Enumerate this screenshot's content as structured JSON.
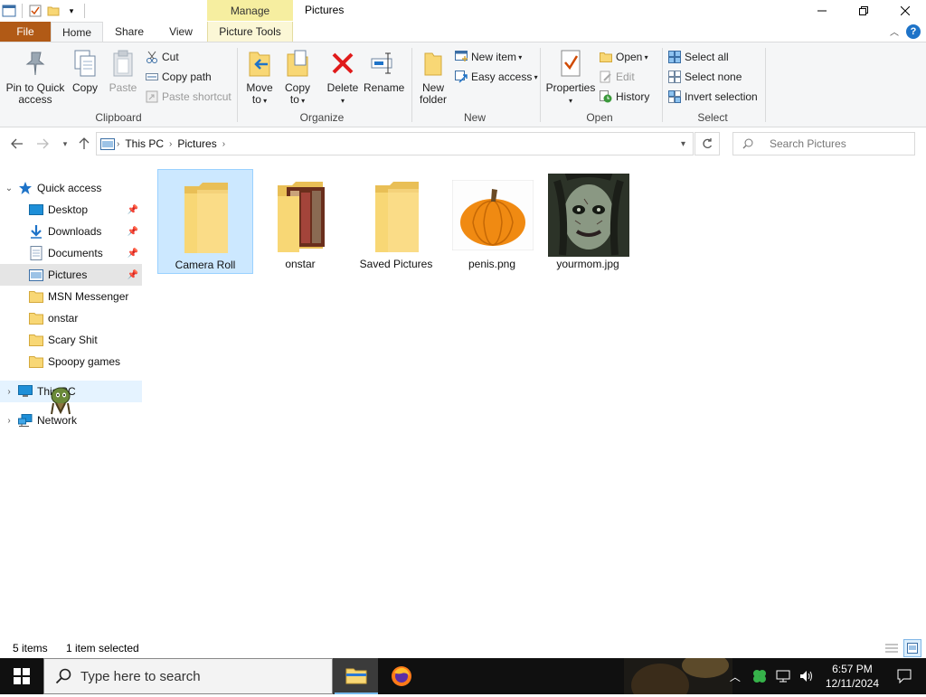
{
  "window": {
    "title": "Pictures",
    "contextual_group": "Manage"
  },
  "ribbon_tabs": {
    "file": "File",
    "home": "Home",
    "share": "Share",
    "view": "View",
    "picture_tools": "Picture Tools"
  },
  "clipboard": {
    "pin": "Pin to Quick access",
    "copy": "Copy",
    "paste": "Paste",
    "cut": "Cut",
    "copy_path": "Copy path",
    "paste_shortcut": "Paste shortcut",
    "label": "Clipboard"
  },
  "organize": {
    "move_to": "Move to",
    "copy_to": "Copy to",
    "delete": "Delete",
    "rename": "Rename",
    "label": "Organize"
  },
  "new": {
    "new_folder": "New folder",
    "new_item": "New item",
    "easy_access": "Easy access",
    "label": "New"
  },
  "open": {
    "properties": "Properties",
    "open": "Open",
    "edit": "Edit",
    "history": "History",
    "label": "Open"
  },
  "select": {
    "select_all": "Select all",
    "select_none": "Select none",
    "invert": "Invert selection",
    "label": "Select"
  },
  "address": {
    "crumbs": [
      "This PC",
      "Pictures"
    ],
    "search_placeholder": "Search Pictures"
  },
  "nav_pane": {
    "quick_access": "Quick access",
    "items": [
      {
        "label": "Desktop",
        "pinned": true
      },
      {
        "label": "Downloads",
        "pinned": true
      },
      {
        "label": "Documents",
        "pinned": true
      },
      {
        "label": "Pictures",
        "pinned": true
      },
      {
        "label": "MSN Messenger",
        "pinned": false
      },
      {
        "label": "onstar",
        "pinned": false
      },
      {
        "label": "Scary Shit",
        "pinned": false
      },
      {
        "label": "Spoopy games",
        "pinned": false
      }
    ],
    "this_pc": "This PC",
    "network": "Network"
  },
  "files": [
    {
      "name": "Camera Roll",
      "kind": "folder",
      "selected": true
    },
    {
      "name": "onstar",
      "kind": "folder-with-preview",
      "selected": false
    },
    {
      "name": "Saved Pictures",
      "kind": "folder",
      "selected": false
    },
    {
      "name": "penis.png",
      "kind": "image-pumpkin",
      "selected": false
    },
    {
      "name": "yourmom.jpg",
      "kind": "image-scary-face",
      "selected": false
    }
  ],
  "status": {
    "count": "5 items",
    "selection": "1 item selected"
  },
  "taskbar": {
    "search_placeholder": "Type here to search",
    "time": "6:57 PM",
    "date": "12/11/2024"
  },
  "colors": {
    "file_tab": "#b15a16",
    "manage_tab": "#f6eea0",
    "selected_item": "#cce8ff",
    "folder": "#f8d775"
  }
}
